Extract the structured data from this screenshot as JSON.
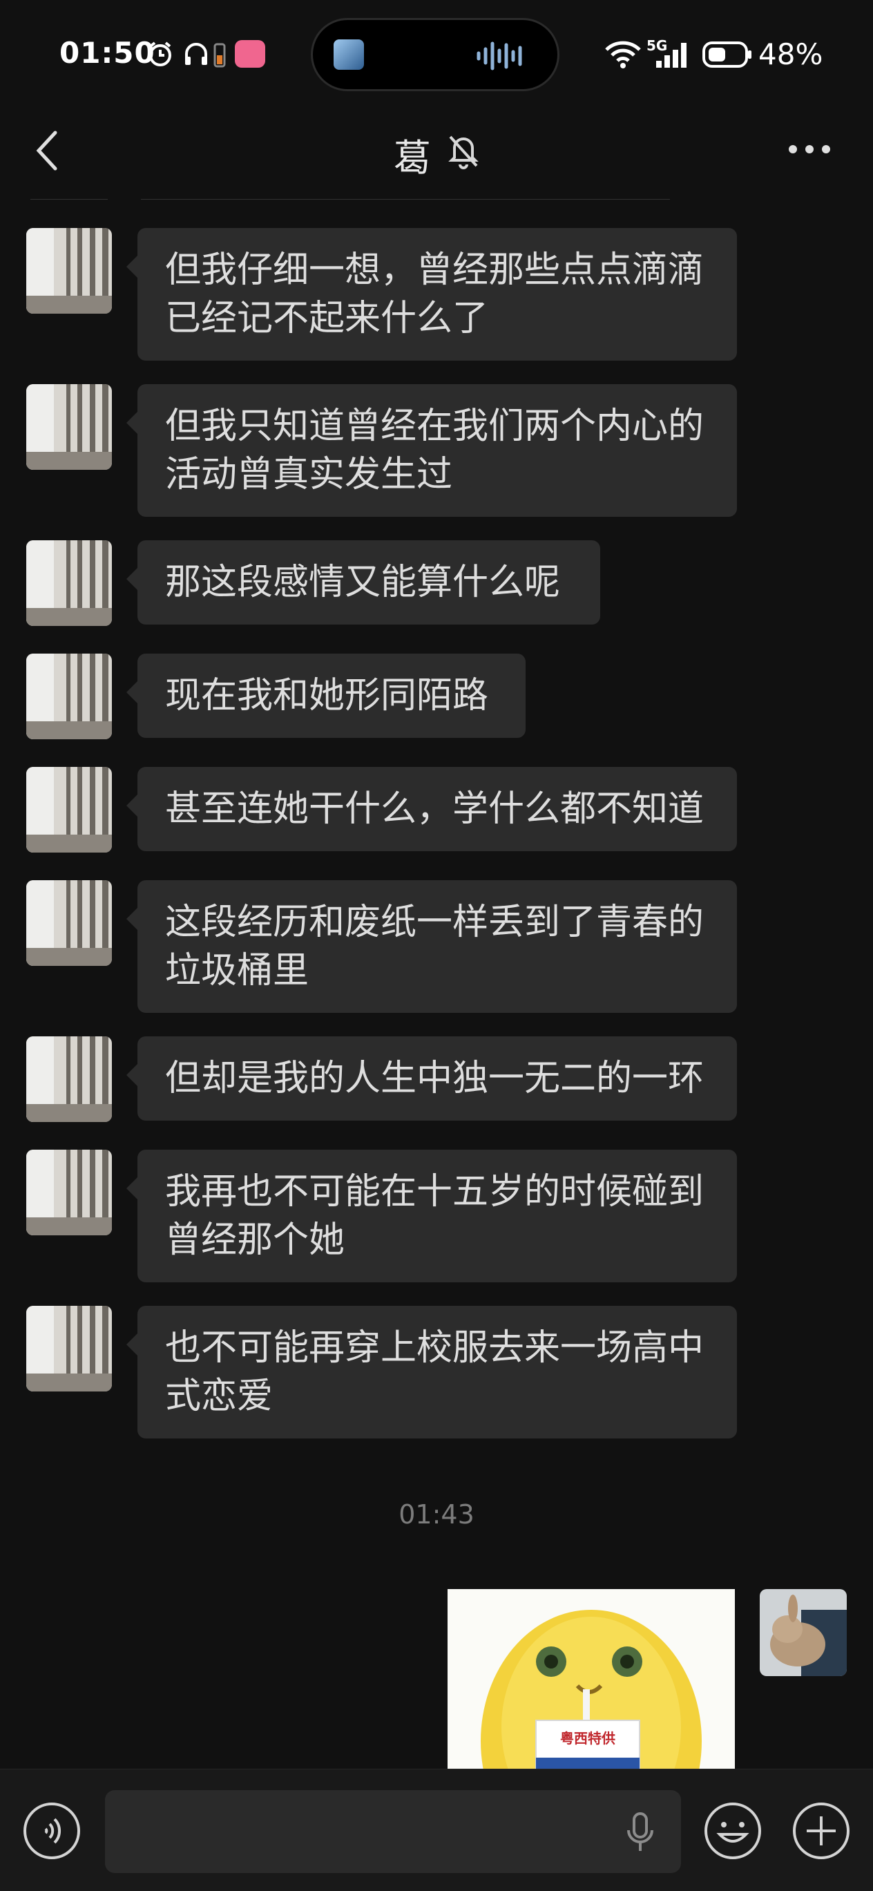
{
  "status_bar": {
    "time": "01:50",
    "network": "5G",
    "battery": "48%",
    "icons": [
      "alarm-icon",
      "headphones-icon",
      "battery-small-icon",
      "bilibili-icon",
      "wifi-icon",
      "signal-icon",
      "battery-icon"
    ]
  },
  "header": {
    "title": "葛",
    "back_icon": "chevron-left-icon",
    "mute_icon": "bell-off-icon",
    "more_icon": "more-dots-icon"
  },
  "messages": [
    {
      "text": "但我仔细一想，曾经那些点点滴滴已经记不起来什么了"
    },
    {
      "text": "但我只知道曾经在我们两个内心的活动曾真实发生过"
    },
    {
      "text": "那这段感情又能算什么呢"
    },
    {
      "text": "现在我和她形同陌路"
    },
    {
      "text": "甚至连她干什么，学什么都不知道"
    },
    {
      "text": "这段经历和废纸一样丢到了青春的垃圾桶里"
    },
    {
      "text": "但却是我的人生中独一无二的一环"
    },
    {
      "text": "我再也不可能在十五岁的时候碰到曾经那个她"
    },
    {
      "text": "也不可能再穿上校服去来一场高中式恋爱"
    }
  ],
  "timestamp": "01:43",
  "sticker": {
    "text": "粤西特供"
  },
  "input_bar": {
    "voice_icon": "voice-icon",
    "mic_icon": "mic-icon",
    "emoji_icon": "emoji-icon",
    "plus_icon": "plus-icon"
  },
  "colors": {
    "background": "#111111",
    "bubble": "#2c2c2c",
    "text": "#dedede"
  }
}
